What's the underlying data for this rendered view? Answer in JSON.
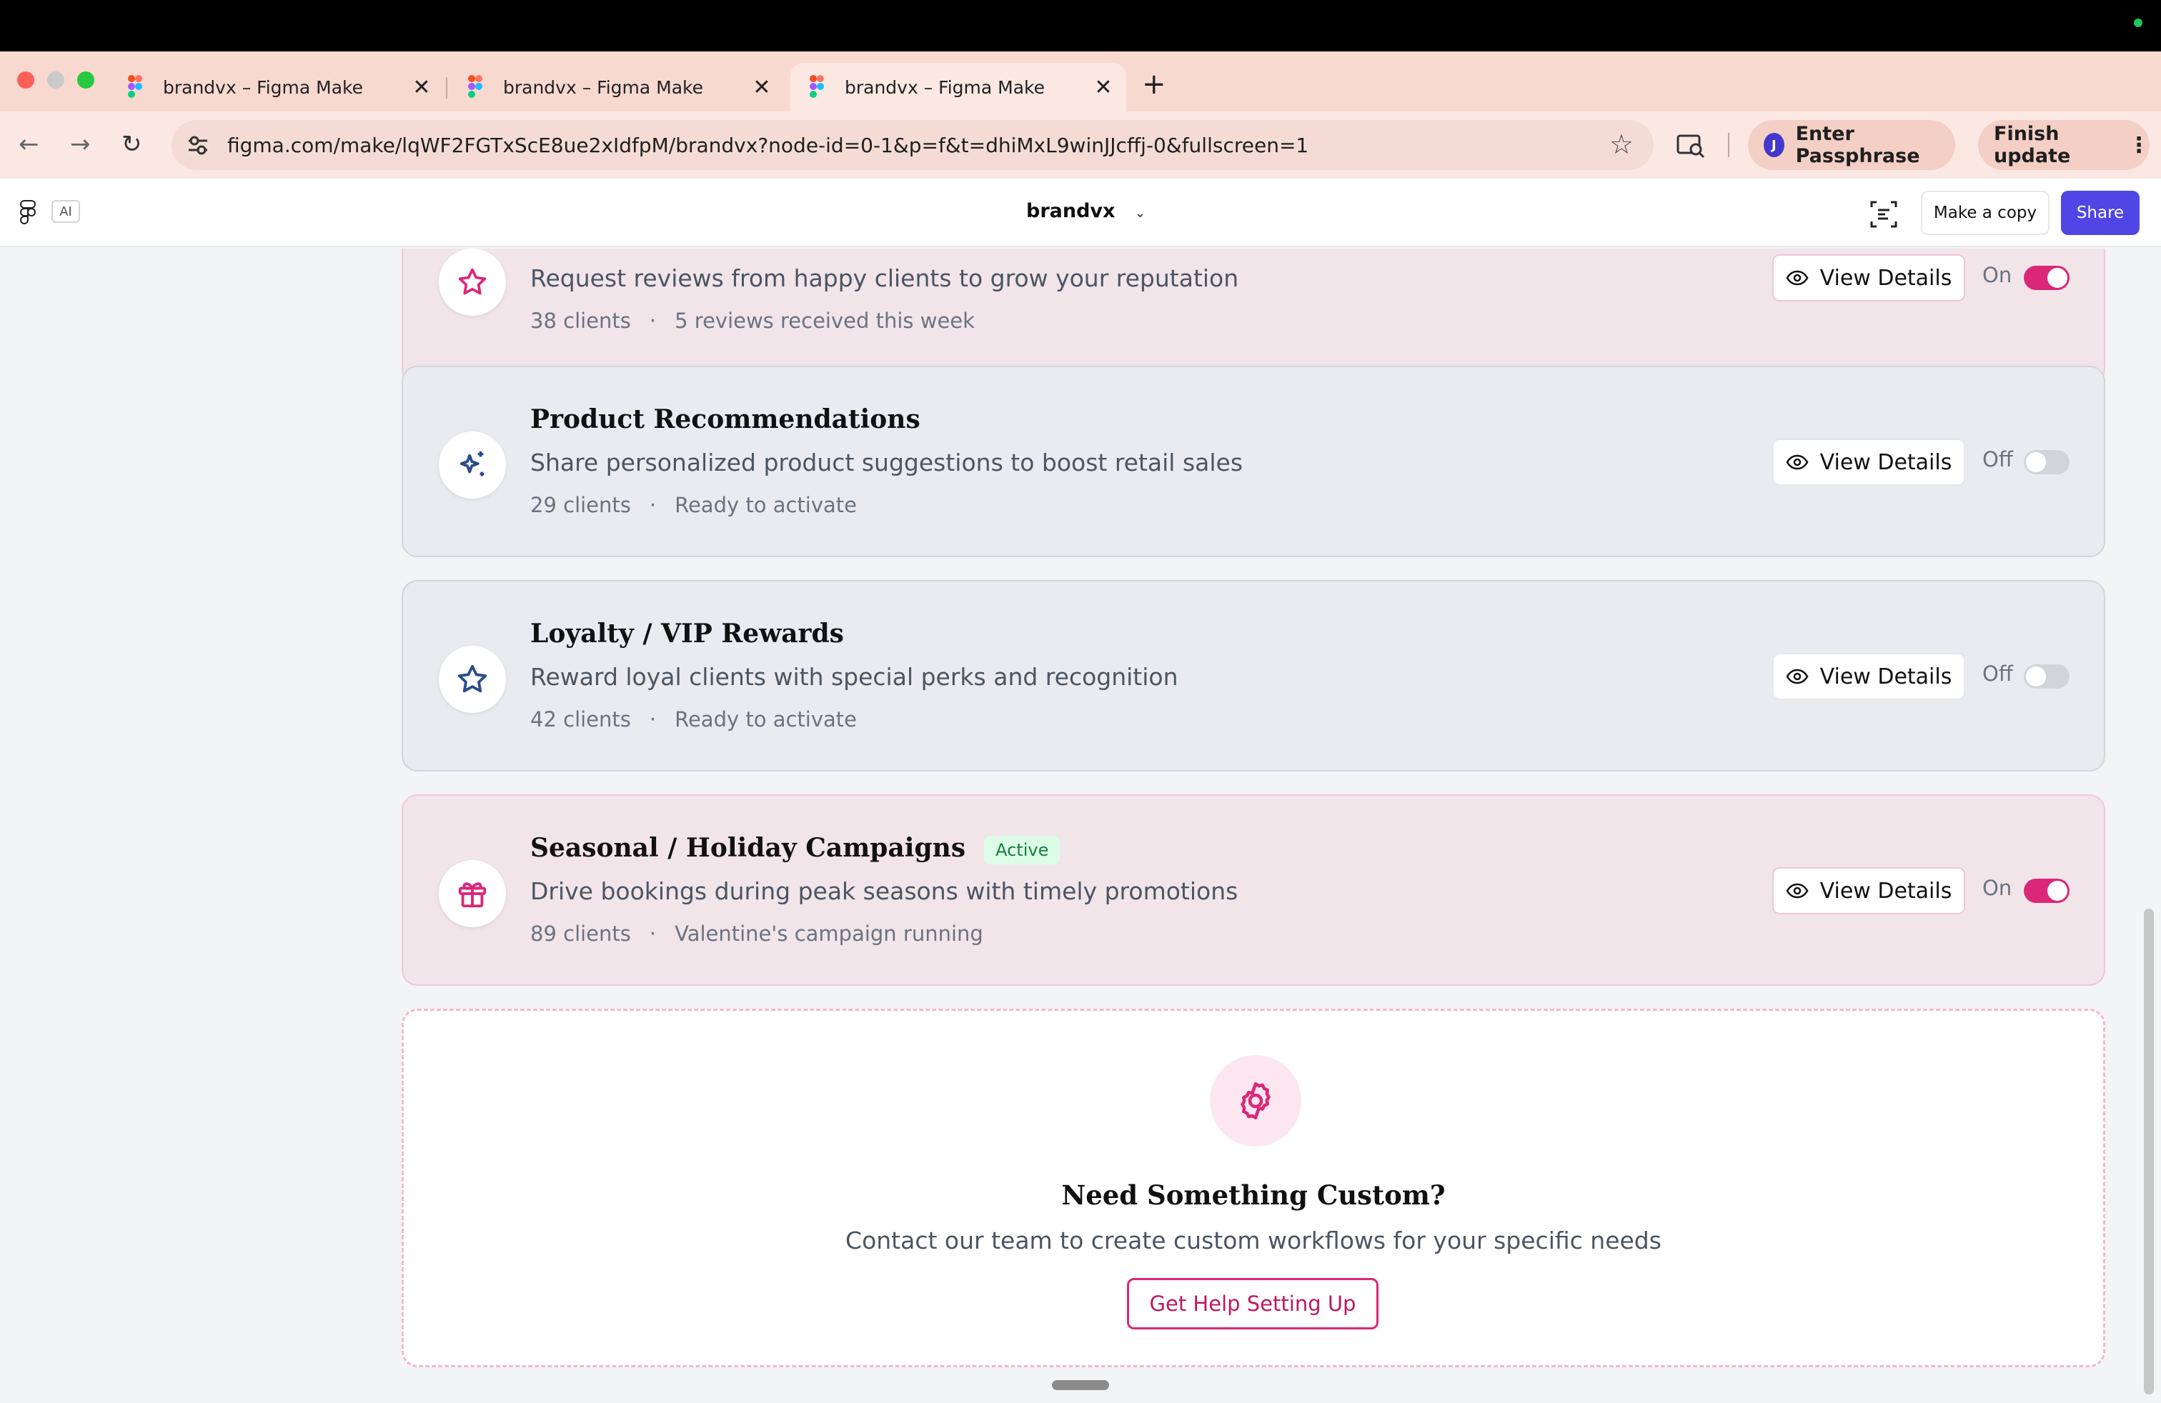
{
  "browser": {
    "tabs": [
      {
        "title": "brandvx – Figma Make",
        "active": false
      },
      {
        "title": "brandvx – Figma Make",
        "active": false
      },
      {
        "title": "brandvx – Figma Make",
        "active": true
      }
    ],
    "new_tab": "+",
    "close_glyph": "✕",
    "url": "figma.com/make/lqWF2FGTxScE8ue2xIdfpM/brandvx?node-id=0-1&p=f&t=dhiMxL9winJJcffj-0&fullscreen=1",
    "profile_button": "Enter Passphrase",
    "profile_initial": "J",
    "update_button": "Finish update"
  },
  "figma_header": {
    "ai_badge": "AI",
    "file_name": "brandvx",
    "make_copy": "Make a copy",
    "share": "Share"
  },
  "cards": [
    {
      "title": "",
      "description": "Request reviews from happy clients to grow your reputation",
      "clients": "38 clients",
      "status": "5 reviews received this week",
      "view_details": "View Details",
      "toggle_label": "On",
      "enabled": true,
      "icon": "star-icon"
    },
    {
      "title": "Product Recommendations",
      "description": "Share personalized product suggestions to boost retail sales",
      "clients": "29 clients",
      "status": "Ready to activate",
      "view_details": "View Details",
      "toggle_label": "Off",
      "enabled": false,
      "icon": "sparkles-icon"
    },
    {
      "title": "Loyalty / VIP Rewards",
      "description": "Reward loyal clients with special perks and recognition",
      "clients": "42 clients",
      "status": "Ready to activate",
      "view_details": "View Details",
      "toggle_label": "Off",
      "enabled": false,
      "icon": "star-icon"
    },
    {
      "title": "Seasonal / Holiday Campaigns",
      "badge": "Active",
      "description": "Drive bookings during peak seasons with timely promotions",
      "clients": "89 clients",
      "status": "Valentine's campaign running",
      "view_details": "View Details",
      "toggle_label": "On",
      "enabled": true,
      "icon": "gift-icon"
    }
  ],
  "custom": {
    "title": "Need Something Custom?",
    "description": "Contact our team to create custom workflows for your specific needs",
    "button": "Get Help Setting Up",
    "icon": "gear-icon"
  },
  "colors": {
    "accent_pink": "#db2777",
    "share_blue": "#4f46e5",
    "active_green": "#15803d"
  }
}
